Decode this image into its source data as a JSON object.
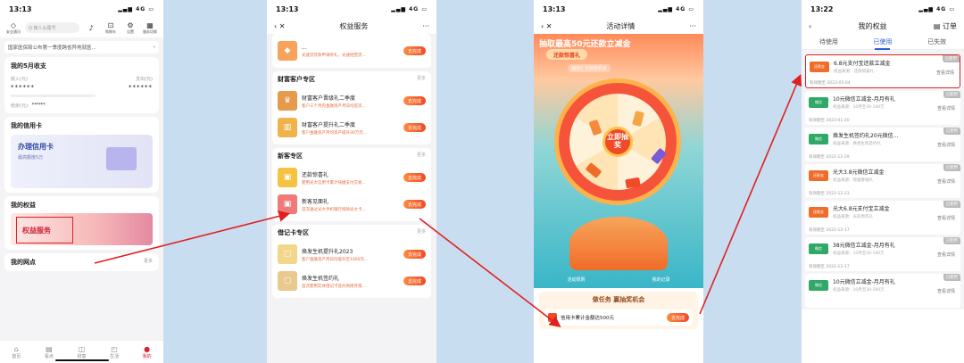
{
  "colors": {
    "accent": "#e02020",
    "orange": "#f04a26",
    "blue": "#2c5fd6"
  },
  "panel1": {
    "time": "13:13",
    "network": "4G",
    "top_icons": [
      {
        "label": "安全通讯",
        "icon": "shield-icon"
      },
      {
        "label": "麦克风",
        "icon": "mic-icon"
      },
      {
        "label": "购物车",
        "icon": "cart-icon"
      },
      {
        "label": "设置",
        "icon": "gear-icon"
      },
      {
        "label": "服务切换",
        "icon": "grid-icon"
      }
    ],
    "search_placeholder": "Q 搜人头尾号",
    "notice": "国家医保局公布第一季度跨省异地就医...",
    "income_title": "我的5月收支",
    "income_label": "收入(元)",
    "expense_label": "支出(元)",
    "income_value": "******",
    "expense_value": "******",
    "balance_label": "结余(元):",
    "balance_value": "******",
    "credit_title": "我的信用卡",
    "credit_main": "办理信用卡",
    "credit_sub": "最高额度5万",
    "rights_title": "我的权益",
    "rights_button": "权益服务",
    "nodes_title": "我的网点",
    "nodes_more": "更多",
    "tabs": [
      {
        "label": "首页",
        "icon": "home-icon"
      },
      {
        "label": "看点",
        "icon": "news-icon"
      },
      {
        "label": "财富",
        "icon": "chart-icon"
      },
      {
        "label": "生活",
        "icon": "bag-icon"
      },
      {
        "label": "我的",
        "icon": "user-icon"
      }
    ]
  },
  "panel2": {
    "time": "13:13",
    "title": "权益服务",
    "top_item": {
      "name": "...",
      "desc": "光速贷贷款申请有礼，光速经营贷...",
      "button": "去完成"
    },
    "sections": [
      {
        "title": "财富客户专区",
        "more": "更多",
        "items": [
          {
            "name": "财富客户晋级礼二季度",
            "desc": "客户三个月内金融资产月日均首次...",
            "button": "去完成"
          },
          {
            "name": "财富客户提升礼二季度",
            "desc": "客户金融资产月均资产提升30万元...",
            "button": "去完成"
          }
        ]
      },
      {
        "title": "新客专区",
        "more": "更多",
        "items": [
          {
            "name": "还款惊喜礼",
            "desc": "使用光大信用卡累计快捷支付交易...",
            "button": "去完成"
          },
          {
            "name": "新客见面礼",
            "desc": "首次通过光大手机银行扣除光大卡...",
            "button": "去完成"
          }
        ]
      },
      {
        "title": "借记卡专区",
        "more": "更多",
        "items": [
          {
            "name": "焕发生机提升礼2023",
            "desc": "客户金融资产月日均提升至1000元...",
            "button": "去完成"
          },
          {
            "name": "焕发生机签约礼",
            "desc": "首次使用实体借记卡签约周周存或...",
            "button": "去完成"
          }
        ]
      }
    ]
  },
  "panel3": {
    "time": "13:13",
    "title": "活动详情",
    "headline": "抽取最高50元还款立减金",
    "subheadline": "还款惊喜礼",
    "count_text": "抽奖0 次抽奖机会",
    "spin_label": "立即抽奖",
    "footer_left": "活动规则",
    "footer_right": "我的记录",
    "task_title": "做任务 赢抽奖机会",
    "task_item": "信用卡累计金额达500元",
    "task_button": "去完成"
  },
  "panel4": {
    "time": "13:22",
    "title": "我的权益",
    "order_label": "订单",
    "tabs": [
      "待使用",
      "已使用",
      "已失效"
    ],
    "cards": [
      {
        "name": "6.8元支付宝还款立减金",
        "source": "权益来源：还款惊喜礼",
        "status": "已使用",
        "view": "查看详情",
        "date": "有效期至 2023-05-04",
        "thumb": "还款金"
      },
      {
        "name": "10元微信立减金-月月有礼",
        "source": "权益来源：10月至30-100万",
        "status": "已使用",
        "view": "查看详情",
        "date": "有效期至 2023-01-20",
        "thumb": "微信"
      },
      {
        "name": "焕发生机签约礼20元微信...",
        "source": "权益来源：焕发生机签约礼",
        "status": "已使用",
        "view": "查看详情",
        "date": "有效期至 2022-12-29",
        "thumb": "微信"
      },
      {
        "name": "光大3.8元微信立减金",
        "source": "权益来源：惊喜春福礼",
        "status": "已使用",
        "view": "查看详情",
        "date": "有效期至 2022-12-23",
        "thumb": "还款金"
      },
      {
        "name": "光大6.8元支付宝立减金",
        "source": "权益来源：光彩周年礼",
        "status": "已使用",
        "view": "查看详情",
        "date": "有效期至 2022-12-17",
        "thumb": "还款金"
      },
      {
        "name": "38元微信立减金-月月有礼",
        "source": "权益来源：10月至30-100万",
        "status": "已使用",
        "view": "查看详情",
        "date": "有效期至 2022-12-17",
        "thumb": "微信"
      },
      {
        "name": "10元微信立减金-月月有礼",
        "source": "权益来源：10月至30-100万",
        "status": "已使用",
        "view": "查看详情",
        "date": "",
        "thumb": "微信"
      }
    ]
  }
}
